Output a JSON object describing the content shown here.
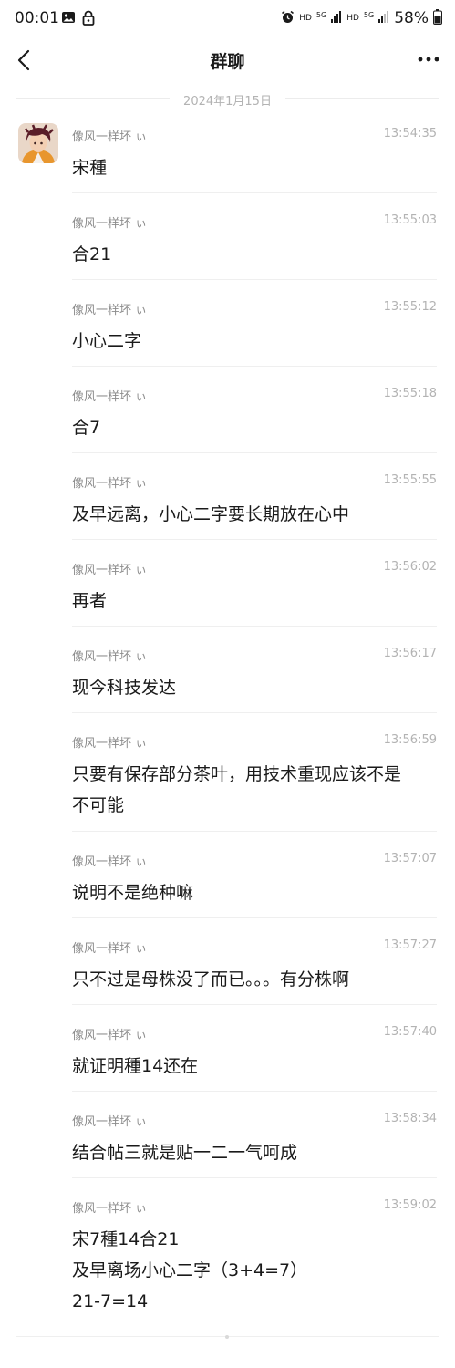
{
  "status_bar": {
    "time": "00:01",
    "network_labels": [
      "HD",
      "5G",
      "HD",
      "5G"
    ],
    "battery_percent": "58%"
  },
  "header": {
    "title": "群聊"
  },
  "date_separator": "2024年1月15日",
  "messages": [
    {
      "sender": "像风一样坏 ぃ",
      "time": "13:54:35",
      "text": "宋種"
    },
    {
      "sender": "像风一样坏 ぃ",
      "time": "13:55:03",
      "text": "合21"
    },
    {
      "sender": "像风一样坏 ぃ",
      "time": "13:55:12",
      "text": "小心二字"
    },
    {
      "sender": "像风一样坏 ぃ",
      "time": "13:55:18",
      "text": "合7"
    },
    {
      "sender": "像风一样坏 ぃ",
      "time": "13:55:55",
      "text": "及早远离，小心二字要长期放在心中"
    },
    {
      "sender": "像风一样坏 ぃ",
      "time": "13:56:02",
      "text": "再者"
    },
    {
      "sender": "像风一样坏 ぃ",
      "time": "13:56:17",
      "text": "现今科技发达"
    },
    {
      "sender": "像风一样坏 ぃ",
      "time": "13:56:59",
      "text": "只要有保存部分茶叶，用技术重现应该不是\n不可能"
    },
    {
      "sender": "像风一样坏 ぃ",
      "time": "13:57:07",
      "text": "说明不是绝种嘛"
    },
    {
      "sender": "像风一样坏 ぃ",
      "time": "13:57:27",
      "text": "只不过是母株没了而已。。。有分株啊"
    },
    {
      "sender": "像风一样坏 ぃ",
      "time": "13:57:40",
      "text": "就证明種14还在"
    },
    {
      "sender": "像风一样坏 ぃ",
      "time": "13:58:34",
      "text": "结合帖三就是贴一二一气呵成"
    },
    {
      "sender": "像风一样坏 ぃ",
      "time": "13:59:02",
      "text": "宋7種14合21\n及早离场小心二字（3+4=7）\n21-7=14"
    }
  ]
}
